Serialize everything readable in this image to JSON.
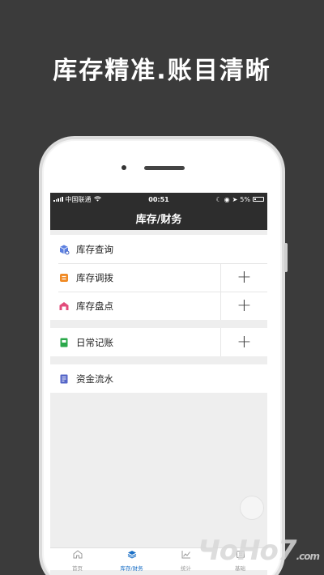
{
  "headline": "库存精准.账目清晰",
  "status_bar": {
    "carrier": "中国联通",
    "time": "00:51",
    "battery": "5%"
  },
  "nav": {
    "title": "库存/财务"
  },
  "groups": [
    {
      "items": [
        {
          "label": "库存查询",
          "icon": "cube-search-icon",
          "color": "#5b7fe0",
          "has_add": false
        },
        {
          "label": "库存调拨",
          "icon": "transfer-icon",
          "color": "#f08a24",
          "has_add": true
        },
        {
          "label": "库存盘点",
          "icon": "warehouse-icon",
          "color": "#e24b7a",
          "has_add": true
        }
      ]
    },
    {
      "items": [
        {
          "label": "日常记账",
          "icon": "ledger-icon",
          "color": "#2aa84a",
          "has_add": true
        }
      ]
    },
    {
      "items": [
        {
          "label": "资金流水",
          "icon": "cashflow-icon",
          "color": "#5566c8",
          "has_add": false
        }
      ]
    }
  ],
  "add_symbol": "+",
  "tabs": [
    {
      "label": "首页",
      "icon": "home-icon",
      "active": false
    },
    {
      "label": "库存/财务",
      "icon": "layers-icon",
      "active": true
    },
    {
      "label": "统计",
      "icon": "chart-icon",
      "active": false
    },
    {
      "label": "基础",
      "icon": "settings-icon",
      "active": false
    }
  ],
  "colors": {
    "accent": "#1a6fc6",
    "bar": "#2d2d2d"
  },
  "watermark": {
    "main": "ЧоНо7",
    "suffix": ".com"
  }
}
